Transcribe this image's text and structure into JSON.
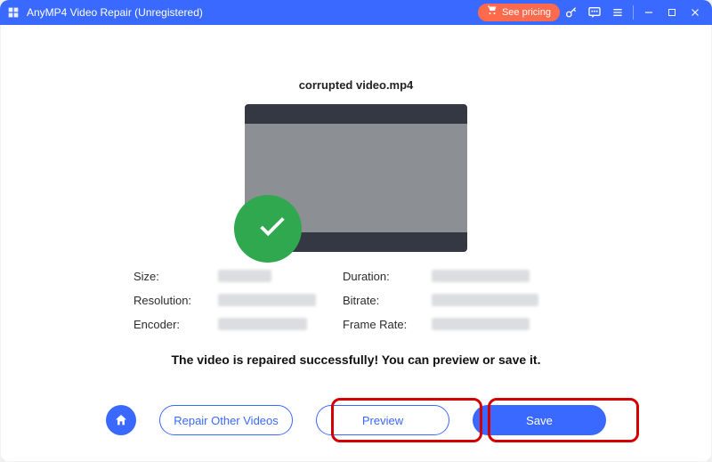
{
  "titlebar": {
    "app_title": "AnyMP4 Video Repair (Unregistered)",
    "see_pricing": "See pricing"
  },
  "file": {
    "name": "corrupted video.mp4"
  },
  "meta": {
    "labels": {
      "size": "Size:",
      "duration": "Duration:",
      "resolution": "Resolution:",
      "bitrate": "Bitrate:",
      "encoder": "Encoder:",
      "frame_rate": "Frame Rate:"
    }
  },
  "status_message": "The video is repaired successfully! You can preview or save it.",
  "actions": {
    "repair_other": "Repair Other Videos",
    "preview": "Preview",
    "save": "Save"
  }
}
